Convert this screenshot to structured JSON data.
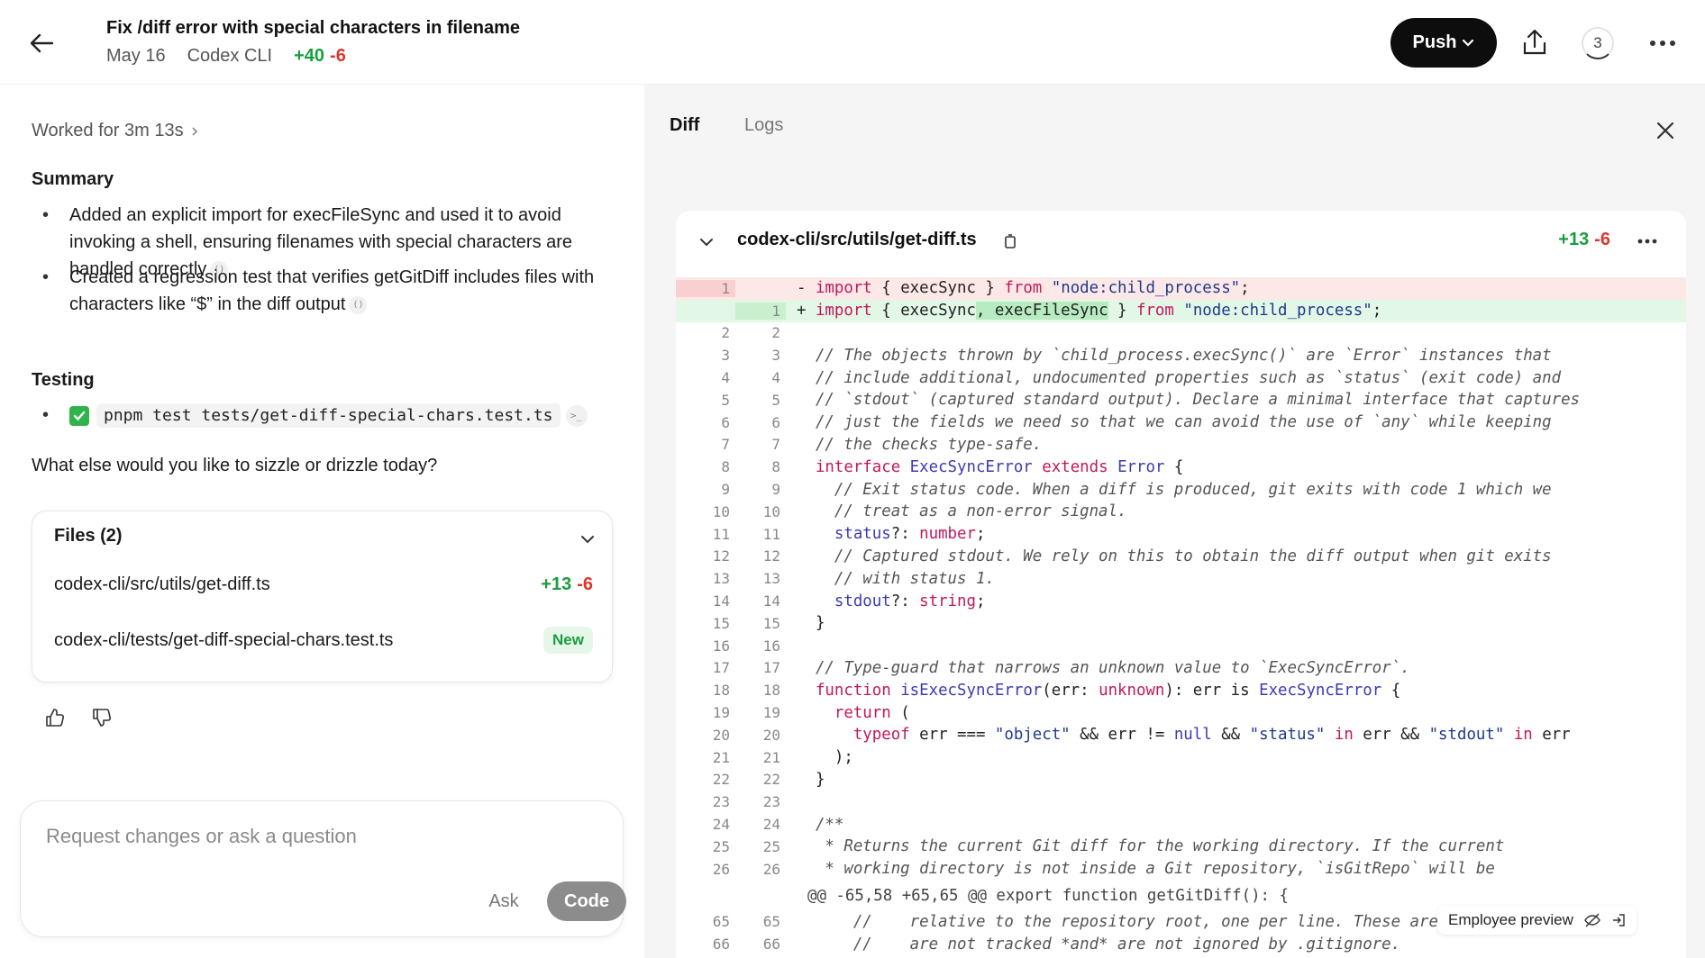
{
  "header": {
    "title": "Fix /diff error with special characters in filename",
    "date": "May 16",
    "source": "Codex CLI",
    "additions": "+40",
    "deletions": "-6",
    "push_label": "Push",
    "notification_count": "3"
  },
  "left": {
    "worked_label": "Worked for 3m 13s",
    "summary_heading": "Summary",
    "summary_items": [
      "Added an explicit import for execFileSync and used it to avoid invoking a shell, ensuring filenames with special characters are handled correctly",
      "Created a regression test that verifies getGitDiff includes files with characters like “$” in the diff output"
    ],
    "testing_heading": "Testing",
    "test_command": "pnpm test tests/get-diff-special-chars.test.ts",
    "question": "What else would you like to sizzle or drizzle today?",
    "files_heading": "Files (2)",
    "files": [
      {
        "path": "codex-cli/src/utils/get-diff.ts",
        "additions": "+13",
        "deletions": "-6"
      },
      {
        "path": "codex-cli/tests/get-diff-special-chars.test.ts",
        "badge": "New"
      }
    ],
    "composer_placeholder": "Request changes or ask a question",
    "ask_label": "Ask",
    "code_label": "Code"
  },
  "right": {
    "tabs": [
      "Diff",
      "Logs"
    ],
    "active_tab": "Diff",
    "file_path": "codex-cli/src/utils/get-diff.ts",
    "additions": "+13",
    "deletions": "-6",
    "hunk_header": "@@ -65,58 +65,65 @@ export function getGitDiff(): {",
    "employee_preview": "Employee preview"
  },
  "colors": {
    "addition": "#1a9c3e",
    "deletion": "#d9362b",
    "push_button": "#0d0d0d"
  }
}
